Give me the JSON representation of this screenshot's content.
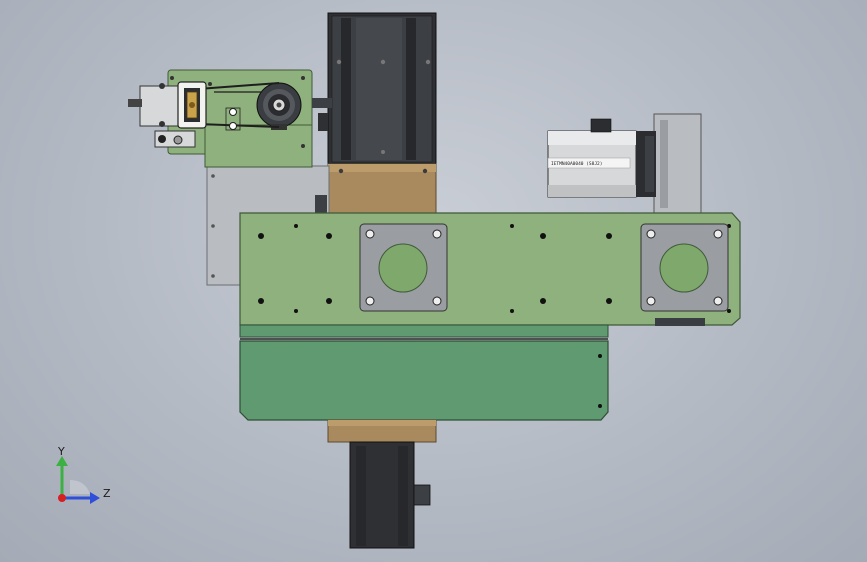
{
  "view": {
    "background_top": "#c9ced6",
    "background_bottom": "#a5abb6"
  },
  "colors": {
    "plate_green": "#8fb17d",
    "plate_green_dark": "#5f8a5a",
    "bearing_green": "#7fa86c",
    "grey_plate": "#b9bcc0",
    "dark_steel": "#3a3d42",
    "brass": "#a98a5e",
    "motor_silver": "#d6d8da",
    "motor_black": "#2b2d30",
    "triad_y": "#3cb043",
    "triad_z": "#2f4fd8",
    "triad_x": "#d42020"
  },
  "motor": {
    "label_text": "IETMN40A0040 (S8J2)"
  },
  "triad": {
    "y_label": "Y",
    "z_label": "Z",
    "icons": [
      "y-axis-arrow-icon",
      "z-axis-arrow-icon",
      "x-axis-origin-icon"
    ]
  }
}
